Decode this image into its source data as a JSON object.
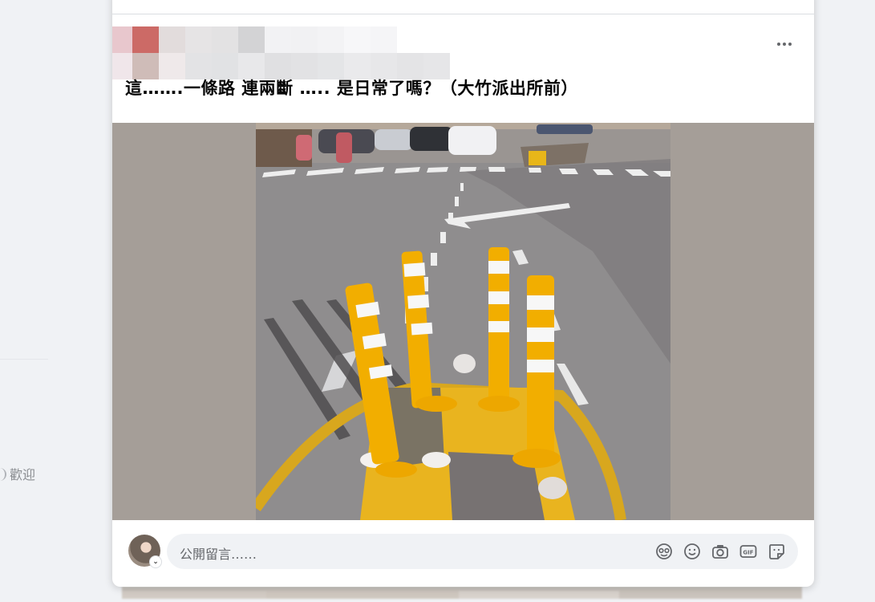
{
  "background": {
    "welcome_text": "歡迎"
  },
  "post": {
    "text": "這…….一條路 連兩斷 ….. 是日常了嗎？（大竹派出所前）",
    "more_options_icon": "more-horizontal-icon"
  },
  "comment_box": {
    "placeholder": "公開留言……",
    "icons": [
      "avatar-sticker-icon",
      "emoji-icon",
      "camera-icon",
      "gif-icon",
      "sticker-icon"
    ]
  },
  "colors": {
    "page_bg": "#f0f2f5",
    "card_bg": "#ffffff",
    "photo_bg": "#a59e98",
    "input_bg": "#f0f2f5",
    "icon_gray": "#65676b"
  }
}
